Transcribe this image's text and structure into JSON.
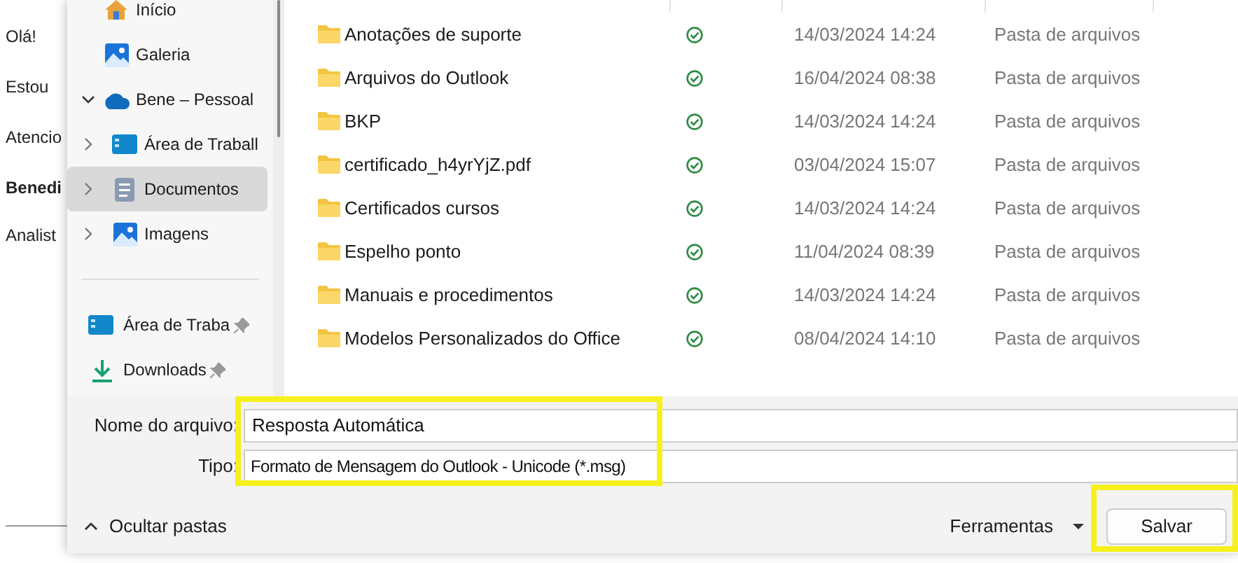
{
  "email_body": {
    "lines": [
      {
        "text": "Olá!",
        "bold": false
      },
      {
        "text": "Estou",
        "bold": false
      },
      {
        "text": "Atencio",
        "bold": false
      },
      {
        "text": "Benedi",
        "bold": true
      },
      {
        "text": "Analist",
        "bold": false
      }
    ]
  },
  "sidebar": {
    "items": [
      {
        "label": "Início",
        "kind": "home",
        "selected": false
      },
      {
        "label": "Galeria",
        "kind": "gallery",
        "selected": false
      },
      {
        "label": "Bene – Pessoal",
        "kind": "cloud",
        "expanded": true,
        "selected": false,
        "children": [
          {
            "label": "Área de Traball",
            "kind": "desktop",
            "expanded": false,
            "selected": false
          },
          {
            "label": "Documentos",
            "kind": "document",
            "expanded": false,
            "selected": true
          },
          {
            "label": "Imagens",
            "kind": "gallery",
            "expanded": false,
            "selected": false
          }
        ]
      }
    ],
    "quick_access": [
      {
        "label": "Área de Traba",
        "kind": "desktop",
        "pinned": true
      },
      {
        "label": "Downloads",
        "kind": "download",
        "pinned": true
      }
    ]
  },
  "files": [
    {
      "name": "Anotações de suporte",
      "modified": "14/03/2024 14:24",
      "type": "Pasta de arquivos"
    },
    {
      "name": "Arquivos do Outlook",
      "modified": "16/04/2024 08:38",
      "type": "Pasta de arquivos"
    },
    {
      "name": "BKP",
      "modified": "14/03/2024 14:24",
      "type": "Pasta de arquivos"
    },
    {
      "name": "certificado_h4yrYjZ.pdf",
      "modified": "03/04/2024 15:07",
      "type": "Pasta de arquivos"
    },
    {
      "name": "Certificados cursos",
      "modified": "14/03/2024 14:24",
      "type": "Pasta de arquivos"
    },
    {
      "name": "Espelho ponto",
      "modified": "11/04/2024 08:39",
      "type": "Pasta de arquivos"
    },
    {
      "name": "Manuais e procedimentos",
      "modified": "14/03/2024 14:24",
      "type": "Pasta de arquivos"
    },
    {
      "name": "Modelos Personalizados do Office",
      "modified": "08/04/2024 14:10",
      "type": "Pasta de arquivos"
    }
  ],
  "form": {
    "filename_label": "Nome do arquivo:",
    "filename_value": "Resposta Automática",
    "type_label": "Tipo:",
    "type_value": "Formato de Mensagem do Outlook - Unicode (*.msg)"
  },
  "footer": {
    "hide_folders": "Ocultar pastas",
    "tools": "Ferramentas",
    "save": "Salvar"
  }
}
